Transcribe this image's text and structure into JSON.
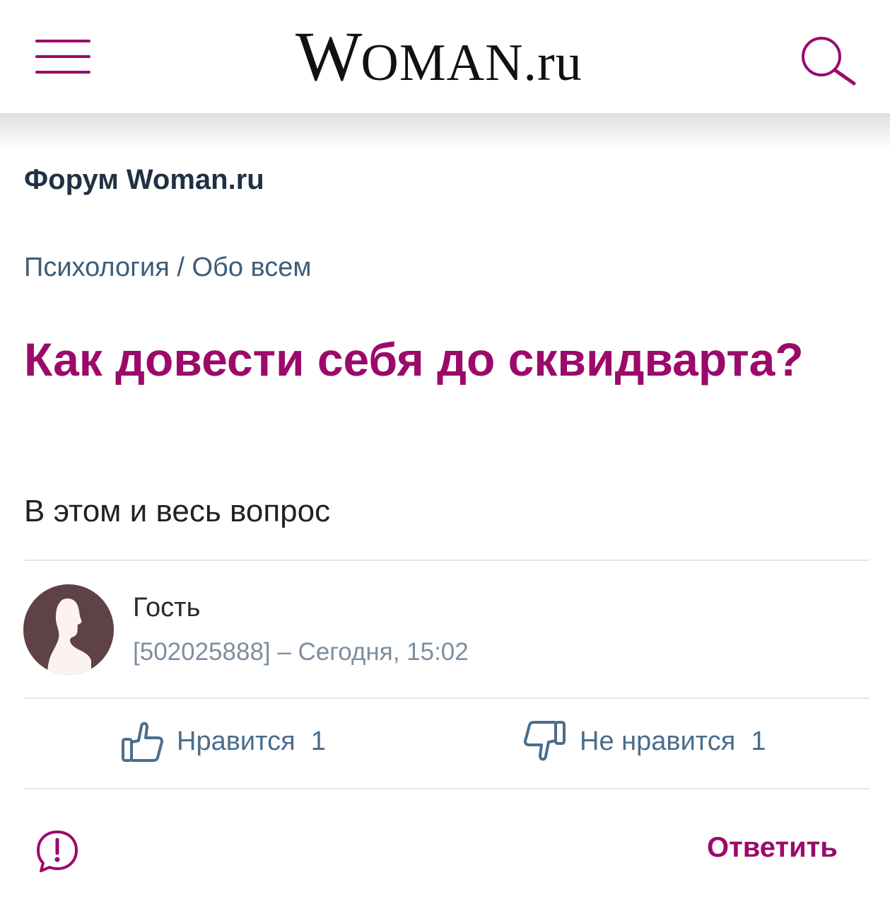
{
  "header": {
    "logo_big": "W",
    "logo_rest": "OMAN",
    "logo_suffix": ".ru",
    "menu_icon": "hamburger-menu-icon",
    "search_icon": "search-icon"
  },
  "forum": {
    "title": "Форум Woman.ru"
  },
  "breadcrumb": {
    "category": "Психология",
    "separator": " / ",
    "subcategory": "Обо всем"
  },
  "topic": {
    "title": "Как довести себя до сквидварта?",
    "body": "В этом и весь вопрос"
  },
  "author": {
    "name": "Гость",
    "meta": "[502025888] – Сегодня, 15:02",
    "avatar_icon": "user-silhouette-icon"
  },
  "votes": {
    "like_label": "Нравится",
    "like_count": "1",
    "dislike_label": "Не нравится",
    "dislike_count": "1"
  },
  "actions": {
    "reply_label": "Ответить",
    "report_icon": "report-icon"
  },
  "colors": {
    "accent": "#9b0a6b",
    "link": "#3d5d7a",
    "avatar_bg": "#5e4245"
  }
}
